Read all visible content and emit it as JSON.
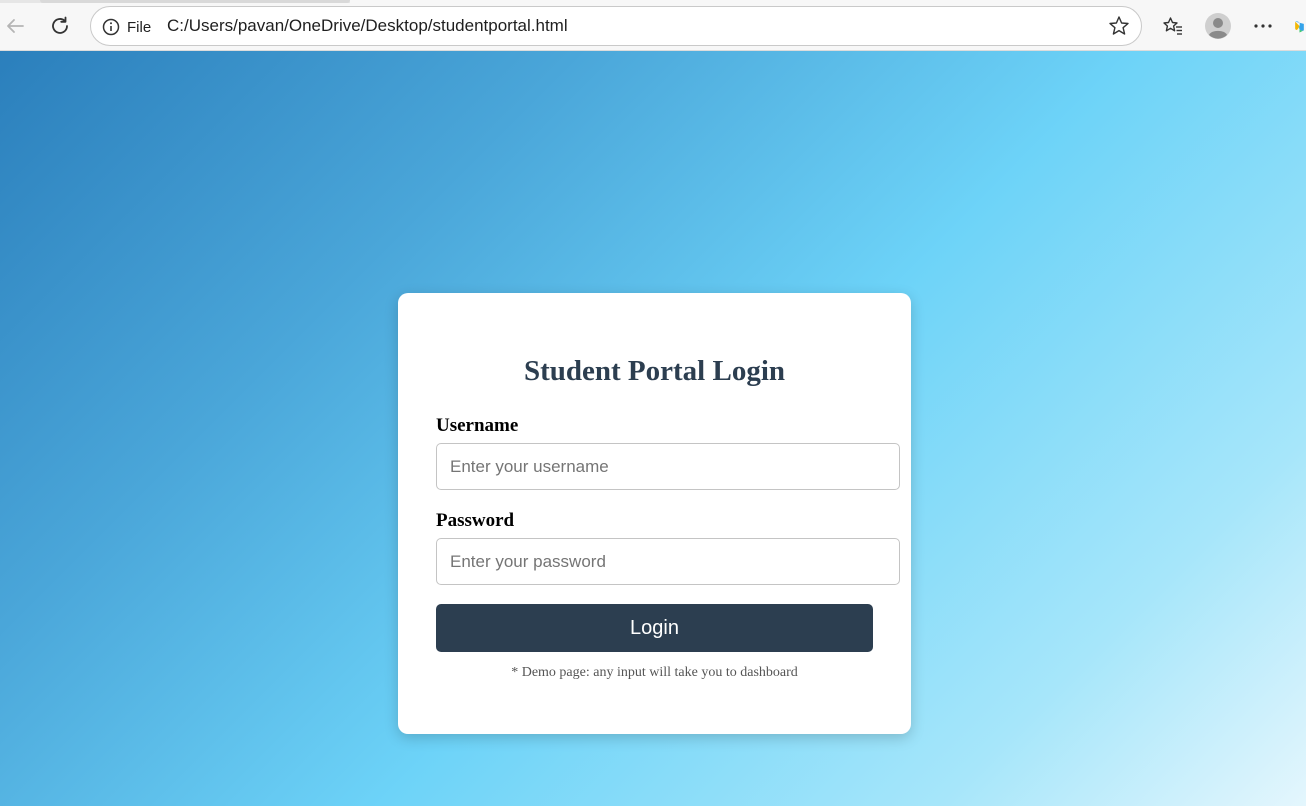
{
  "browser": {
    "site_info_label": "File",
    "url": "C:/Users/pavan/OneDrive/Desktop/studentportal.html",
    "icons": [
      "back-arrow-icon",
      "reload-icon",
      "info-icon",
      "star-icon",
      "favorites-icon",
      "profile-avatar-icon",
      "more-icon",
      "copilot-icon"
    ]
  },
  "login": {
    "title": "Student Portal Login",
    "username_label": "Username",
    "username_placeholder": "Enter your username",
    "username_value": "",
    "password_label": "Password",
    "password_placeholder": "Enter your password",
    "password_value": "",
    "submit_label": "Login",
    "note": "* Demo page: any input will take you to dashboard"
  },
  "colors": {
    "accent": "#2c3e50",
    "gradient_start": "#2b7fbc",
    "gradient_mid": "#6dd3f8",
    "gradient_end": "#e4f6fd",
    "card_background": "#ffffff"
  }
}
